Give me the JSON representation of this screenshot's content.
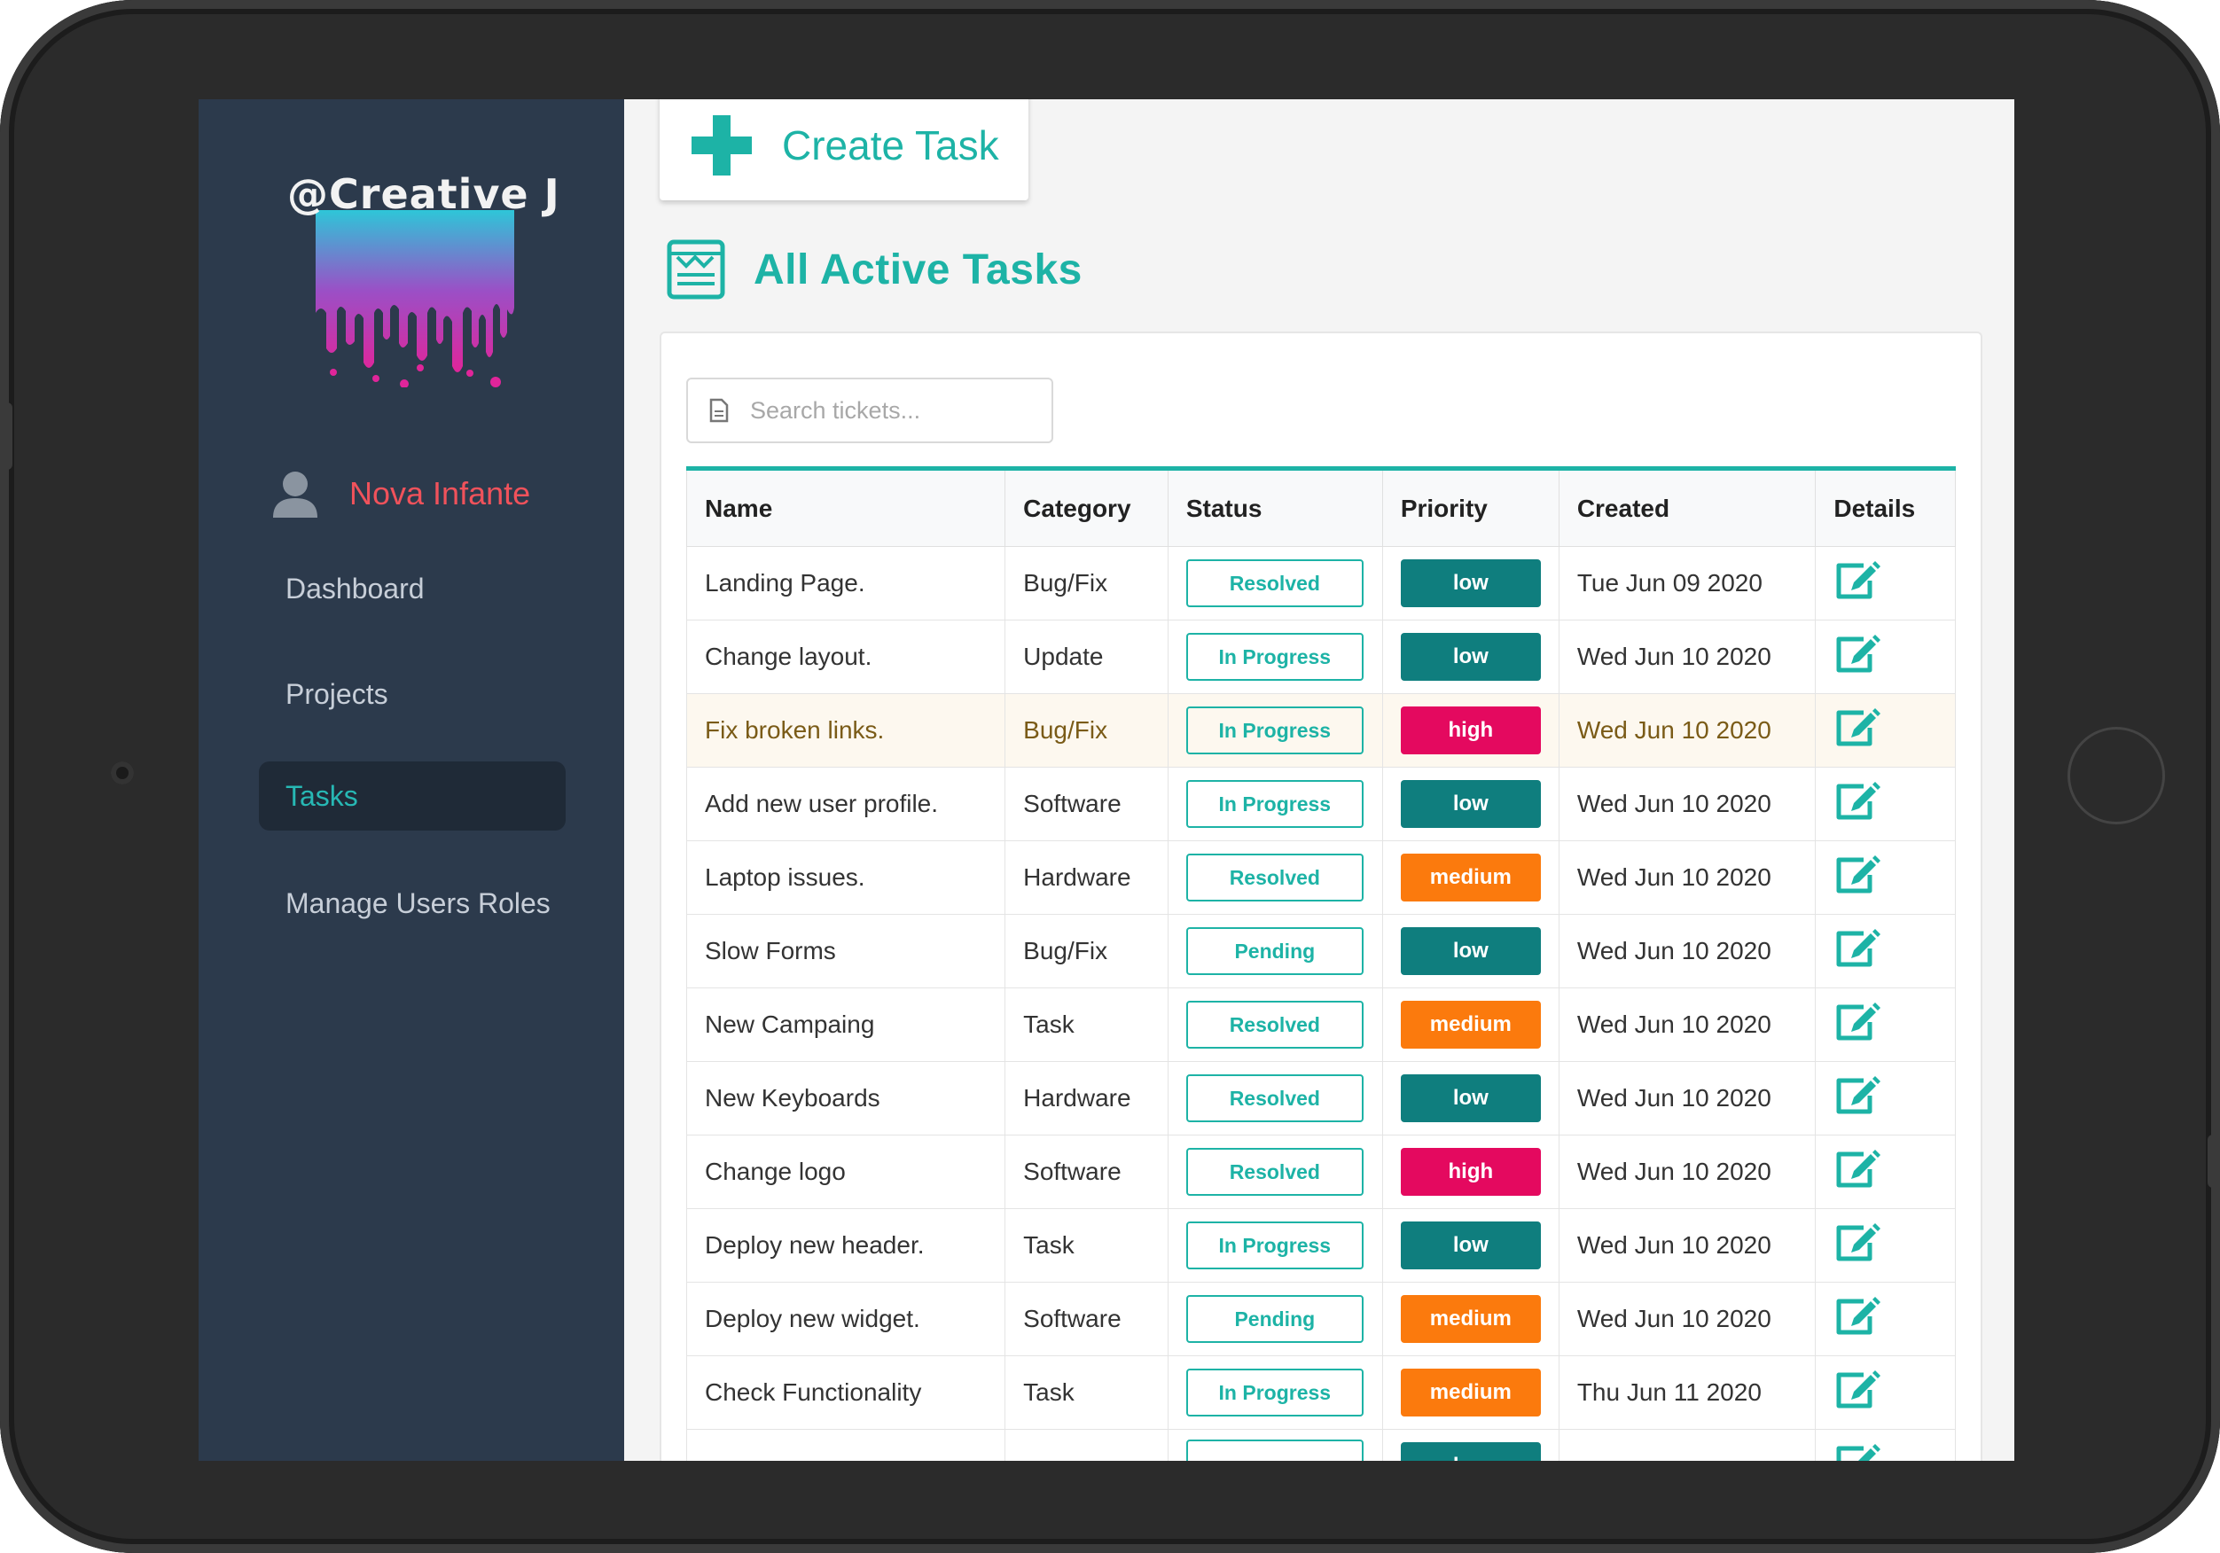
{
  "brand": {
    "title": "@Creative J"
  },
  "user": {
    "name": "Nova Infante"
  },
  "nav": {
    "items": [
      {
        "label": "Dashboard",
        "active": false
      },
      {
        "label": "Projects",
        "active": false
      },
      {
        "label": "Tasks",
        "active": true
      },
      {
        "label": "Manage Users Roles",
        "active": false
      }
    ]
  },
  "create": {
    "label": "Create Task"
  },
  "section": {
    "title": "All Active Tasks"
  },
  "search": {
    "placeholder": "Search tickets..."
  },
  "colors": {
    "accent": "#1db3a6",
    "low": "#0f7e7e",
    "medium": "#fb7a0d",
    "high": "#e4095f",
    "user_name": "#f0525b"
  },
  "table": {
    "headers": [
      "Name",
      "Category",
      "Status",
      "Priority",
      "Created",
      "Details"
    ],
    "rows": [
      {
        "name": "Landing Page.",
        "category": "Bug/Fix",
        "status": "Resolved",
        "priority": "low",
        "created": "Tue Jun 09 2020"
      },
      {
        "name": "Change layout.",
        "category": "Update",
        "status": "In Progress",
        "priority": "low",
        "created": "Wed Jun 10 2020"
      },
      {
        "name": "Fix broken links.",
        "category": "Bug/Fix",
        "status": "In Progress",
        "priority": "high",
        "created": "Wed Jun 10 2020",
        "highlight": true
      },
      {
        "name": "Add new user profile.",
        "category": "Software",
        "status": "In Progress",
        "priority": "low",
        "created": "Wed Jun 10 2020"
      },
      {
        "name": "Laptop issues.",
        "category": "Hardware",
        "status": "Resolved",
        "priority": "medium",
        "created": "Wed Jun 10 2020"
      },
      {
        "name": "Slow Forms",
        "category": "Bug/Fix",
        "status": "Pending",
        "priority": "low",
        "created": "Wed Jun 10 2020"
      },
      {
        "name": "New Campaing",
        "category": "Task",
        "status": "Resolved",
        "priority": "medium",
        "created": "Wed Jun 10 2020"
      },
      {
        "name": "New Keyboards",
        "category": "Hardware",
        "status": "Resolved",
        "priority": "low",
        "created": "Wed Jun 10 2020"
      },
      {
        "name": "Change logo",
        "category": "Software",
        "status": "Resolved",
        "priority": "high",
        "created": "Wed Jun 10 2020"
      },
      {
        "name": "Deploy new header.",
        "category": "Task",
        "status": "In Progress",
        "priority": "low",
        "created": "Wed Jun 10 2020"
      },
      {
        "name": "Deploy new widget.",
        "category": "Software",
        "status": "Pending",
        "priority": "medium",
        "created": "Wed Jun 10 2020"
      },
      {
        "name": "Check Functionality",
        "category": "Task",
        "status": "In Progress",
        "priority": "medium",
        "created": "Thu Jun 11 2020"
      },
      {
        "name": "",
        "category": "",
        "status": "",
        "priority": "low",
        "created": ""
      }
    ]
  },
  "icons": {
    "create": "plus-icon",
    "section": "newspaper-icon",
    "search": "document-icon",
    "user": "user-avatar-icon",
    "details": "edit-icon"
  }
}
